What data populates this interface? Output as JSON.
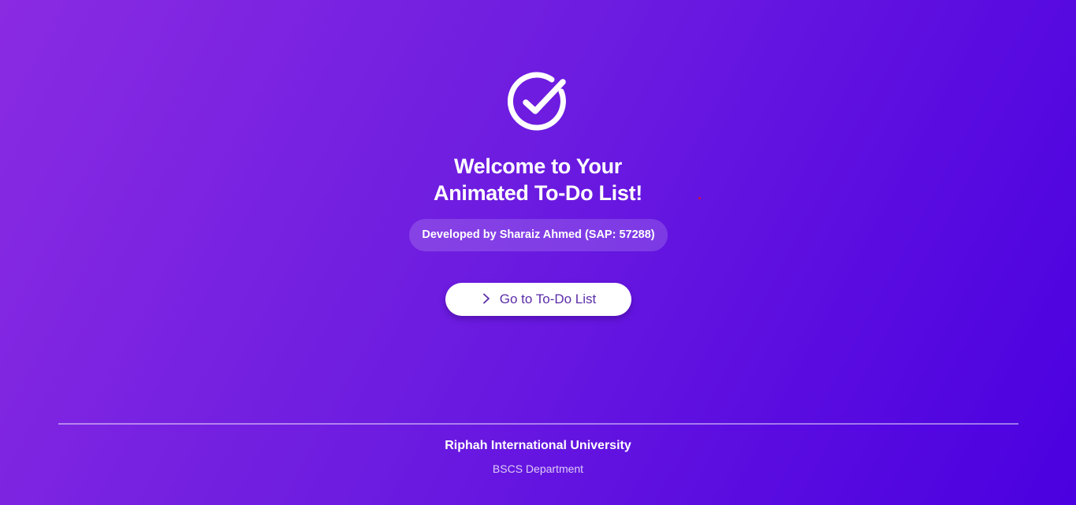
{
  "hero": {
    "logo_icon": "check-circle-icon",
    "title_line1": "Welcome to Your",
    "title_line2": "Animated To-Do List!",
    "developer_badge": "Developed by Sharaiz Ahmed (SAP: 57288)",
    "cta": {
      "icon": "chevron-right-icon",
      "label": "Go to To-Do List"
    }
  },
  "footer": {
    "university": "Riphah International University",
    "department": "BSCS Department"
  },
  "colors": {
    "gradient_start": "#8a2be2",
    "gradient_end": "#4a00e0",
    "button_text": "#5a2ca8"
  }
}
